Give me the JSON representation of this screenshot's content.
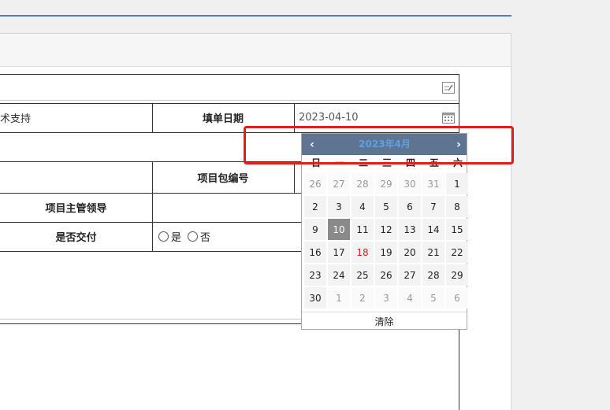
{
  "form": {
    "row1_left": "术支持",
    "fill_date_label": "填单日期",
    "fill_date_value": "2023-04-10",
    "package_no_label": "项目包编号",
    "leader_label": "项目主管领导",
    "delivered_label": "是否交付",
    "radio_yes": "是",
    "radio_no": "否"
  },
  "calendar": {
    "title": "2023年4月",
    "prev": "‹",
    "next": "›",
    "weekdays": [
      "日",
      "一",
      "二",
      "三",
      "四",
      "五",
      "六"
    ],
    "days": [
      [
        "26",
        "27",
        "28",
        "29",
        "30",
        "31",
        "1"
      ],
      [
        "2",
        "3",
        "4",
        "5",
        "6",
        "7",
        "8"
      ],
      [
        "9",
        "10",
        "11",
        "12",
        "13",
        "14",
        "15"
      ],
      [
        "16",
        "17",
        "18",
        "19",
        "20",
        "21",
        "22"
      ],
      [
        "23",
        "24",
        "25",
        "26",
        "27",
        "28",
        "29"
      ],
      [
        "30",
        "1",
        "2",
        "3",
        "4",
        "5",
        "6"
      ]
    ],
    "clear_label": "清除"
  },
  "icons": [
    "note-edit-icon",
    "calendar-icon"
  ],
  "colors": {
    "header_bar": "#5d7590",
    "title_text": "#5e9fe6",
    "highlight_box": "#e51c1c",
    "today_bg": "#8a8a8a",
    "holiday_text": "#d02020",
    "top_line": "#4a7fc0"
  }
}
